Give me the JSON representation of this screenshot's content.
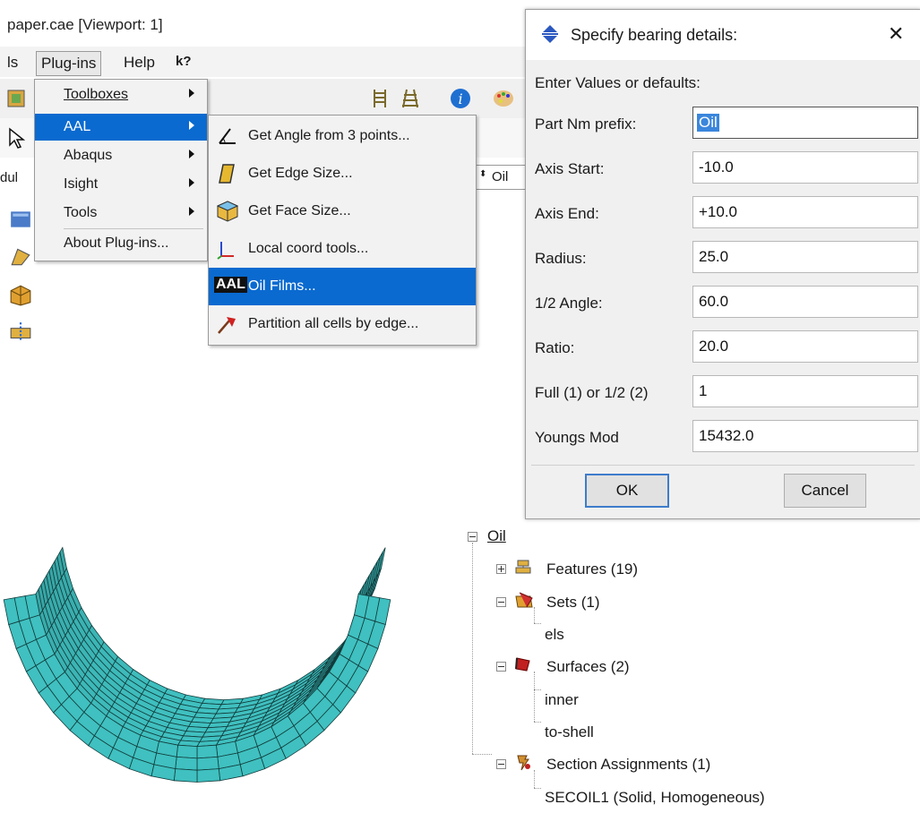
{
  "window": {
    "title": "paper.cae [Viewport: 1]"
  },
  "menubar": {
    "items": [
      "ls",
      "Plug-ins",
      "Help",
      "k?"
    ]
  },
  "toolbar": {
    "module_combo": "Oil",
    "module_label": "dul"
  },
  "plugins_menu": {
    "items": [
      {
        "label": "Toolboxes",
        "submenu": true
      },
      {
        "label": "AAL",
        "submenu": true,
        "selected": true
      },
      {
        "label": "Abaqus",
        "submenu": true
      },
      {
        "label": "Isight",
        "submenu": true
      },
      {
        "label": "Tools",
        "submenu": true
      },
      {
        "label": "About Plug-ins...",
        "submenu": false
      }
    ]
  },
  "aal_menu": {
    "items": [
      {
        "label": "Get Angle from 3 points...",
        "icon": "angle-icon"
      },
      {
        "label": "Get Edge Size...",
        "icon": "edge-size-icon"
      },
      {
        "label": "Get Face Size...",
        "icon": "face-size-icon"
      },
      {
        "label": "Local coord tools...",
        "icon": "coord-axes-icon"
      },
      {
        "label": "Oil Films...",
        "icon": "aal-logo-icon",
        "badge": "AAL",
        "selected": true
      },
      {
        "label": "Partition all cells by edge...",
        "icon": "partition-axe-icon"
      }
    ]
  },
  "dialog": {
    "title": "Specify bearing details:",
    "hint": "Enter Values or defaults:",
    "fields": [
      {
        "label": "Part Nm prefix:",
        "value": "Oil"
      },
      {
        "label": "Axis Start:",
        "value": "-10.0"
      },
      {
        "label": "Axis End:",
        "value": "+10.0"
      },
      {
        "label": "Radius:",
        "value": "25.0"
      },
      {
        "label": "1/2 Angle:",
        "value": "60.0"
      },
      {
        "label": "Ratio:",
        "value": "20.0"
      },
      {
        "label": "Full (1) or 1/2 (2)",
        "value": "1"
      },
      {
        "label": "Youngs Mod",
        "value": "15432.0"
      }
    ],
    "ok_label": "OK",
    "cancel_label": "Cancel",
    "close_glyph": "✕"
  },
  "model_tree": {
    "root": "Oil",
    "nodes": [
      {
        "label": "Features (19)",
        "icon": "features-icon"
      },
      {
        "label": "Sets (1)",
        "icon": "sets-icon",
        "children": [
          "els"
        ]
      },
      {
        "label": "Surfaces (2)",
        "icon": "surfaces-icon",
        "children": [
          "inner",
          "to-shell"
        ]
      },
      {
        "label": "Section Assignments (1)",
        "icon": "section-assignment-icon",
        "children": [
          "SECOIL1 (Solid, Homogeneous)"
        ]
      }
    ]
  },
  "colors": {
    "selection": "#0a6ad0",
    "mesh_fill": "#40c0c0",
    "mesh_lines": "#123c3c"
  }
}
